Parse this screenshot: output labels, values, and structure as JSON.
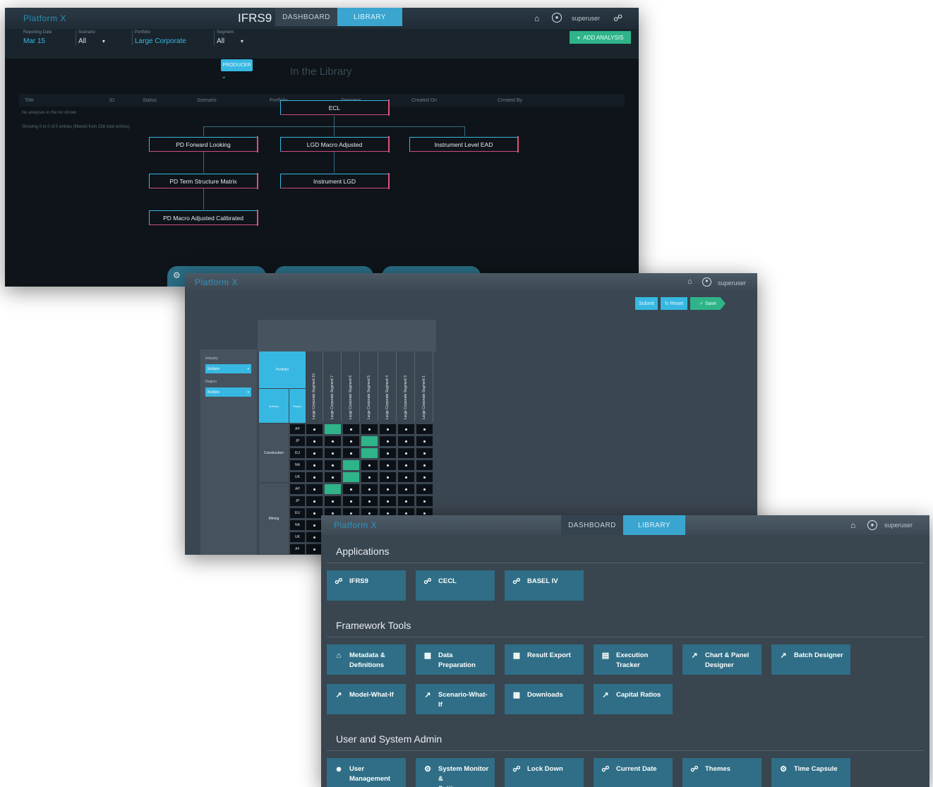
{
  "win1": {
    "brand": "Platform X",
    "app_title": "IFRS9",
    "tabs": [
      "DASHBOARD",
      "LIBRARY"
    ],
    "user": "superuser",
    "filters": [
      {
        "label": "Reporting Date",
        "value": "Mar 15"
      },
      {
        "label": "Scenario",
        "value": "All"
      },
      {
        "label": "Portfolio",
        "value": "Large Corporate"
      },
      {
        "label": "Segment",
        "value": "All"
      }
    ],
    "add_button": "ADD ANALYSIS",
    "badge": "PRODUCER",
    "library_title": "In the Library",
    "columns": [
      "Title",
      "ID",
      "Status",
      "Scenario",
      "Portfolio",
      "Segment",
      "Created On",
      "Created By"
    ],
    "row_text_1": "No analyses in the list shown",
    "row_text_2": "Showing 0 to 0 of 0 entries (filtered from 256 total entries)",
    "nodes": {
      "ecl": "ECL",
      "pd_forward": "PD Forward Looking",
      "lgd_macro": "LGD Macro Adjusted",
      "ead": "Instrument Level EAD",
      "pd_term": "PD Term Structure Matrix",
      "instrument_lgd": "Instrument LGD",
      "pd_macro": "PD Macro Adjusted Calibrated"
    }
  },
  "win2": {
    "brand": "Platform X",
    "user": "superuser",
    "buttons": [
      "Submit",
      "Reset",
      "Save"
    ],
    "filters": [
      {
        "label": "Industry",
        "value": "Multiple"
      },
      {
        "label": "Region",
        "value": "Multiple"
      }
    ],
    "grid": {
      "header_main": "Portfolio",
      "header_industry": "Industry",
      "header_region": "Region",
      "columns": [
        "Large Corporate Segment 10",
        "Large Corporate Segment 7",
        "Large Corporate Segment 6",
        "Large Corporate Segment 5",
        "Large Corporate Segment 4",
        "Large Corporate Segment 3",
        "Large Corporate Segment 1"
      ],
      "groups": [
        {
          "name": "Construction",
          "rows": [
            "AP",
            "JP",
            "EU",
            "NA",
            "UK"
          ]
        },
        {
          "name": "Mining",
          "rows": [
            "AP",
            "JP",
            "EU",
            "NA",
            "UK",
            "AF"
          ]
        }
      ]
    }
  },
  "win3": {
    "brand": "Platform X",
    "tabs": [
      "DASHBOARD",
      "LIBRARY"
    ],
    "user": "superuser",
    "sections": [
      {
        "title": "Applications",
        "tiles": [
          {
            "icon": "link-icon",
            "label": "IFRS9"
          },
          {
            "icon": "link-icon",
            "label": "CECL"
          },
          {
            "icon": "link-icon",
            "label": "BASEL IV"
          }
        ]
      },
      {
        "title": "Framework Tools",
        "tiles": [
          {
            "icon": "home-icon",
            "label": "Metadata &\nDefinitions"
          },
          {
            "icon": "table-icon",
            "label": "Data Preparation"
          },
          {
            "icon": "table-icon",
            "label": "Result Export"
          },
          {
            "icon": "calculator-icon",
            "label": "Execution Tracker"
          },
          {
            "icon": "chart-icon",
            "label": "Chart & Panel\nDesigner"
          },
          {
            "icon": "chart-icon",
            "label": "Batch Designer"
          },
          {
            "icon": "chart-icon",
            "label": "Model-What-If"
          },
          {
            "icon": "chart-icon",
            "label": "Scenario-What-If"
          },
          {
            "icon": "table-icon",
            "label": "Downloads"
          },
          {
            "icon": "chart-icon",
            "label": "Capital Ratios"
          }
        ]
      },
      {
        "title": "User and System Admin",
        "tiles": [
          {
            "icon": "users-icon",
            "label": "User\nManagement"
          },
          {
            "icon": "gear-icon",
            "label": "System Monitor &\nSettings"
          },
          {
            "icon": "link-icon",
            "label": "Lock Down"
          },
          {
            "icon": "link-icon",
            "label": "Current Date"
          },
          {
            "icon": "link-icon",
            "label": "Themes"
          },
          {
            "icon": "gear-icon",
            "label": "Time Capsule"
          }
        ]
      }
    ]
  },
  "colors": {
    "accent": "#37b8e3",
    "tile": "#2f6e86",
    "highlight": "#2fb48a",
    "node_border_right": "#e0507a"
  }
}
